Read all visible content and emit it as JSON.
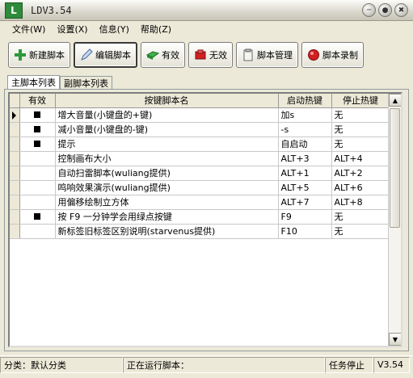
{
  "window": {
    "title": "LDV3.54",
    "icon_letter": "L"
  },
  "menu": [
    {
      "label": "文件(W)"
    },
    {
      "label": "设置(X)"
    },
    {
      "label": "信息(Y)"
    },
    {
      "label": "帮助(Z)"
    }
  ],
  "toolbar": {
    "new_label": "新建脚本",
    "edit_label": "编辑脚本",
    "enable_label": "有效",
    "disable_label": "无效",
    "manage_label": "脚本管理",
    "record_label": "脚本录制"
  },
  "tabs": [
    {
      "label": "主脚本列表"
    },
    {
      "label": "副脚本列表"
    }
  ],
  "grid": {
    "headers": {
      "enabled": "有效",
      "name": "按键脚本名",
      "start": "启动热键",
      "stop": "停止热键"
    },
    "rows": [
      {
        "enabled": true,
        "name": "增大音量(小键盘的+键)",
        "start": "加s",
        "stop": "无"
      },
      {
        "enabled": true,
        "name": "减小音量(小键盘的-键)",
        "start": "-s",
        "stop": "无"
      },
      {
        "enabled": true,
        "name": "提示",
        "start": "自启动",
        "stop": "无"
      },
      {
        "enabled": false,
        "name": "控制画布大小",
        "start": "ALT+3",
        "stop": "ALT+4"
      },
      {
        "enabled": false,
        "name": "自动扫雷脚本(wuliang提供)",
        "start": "ALT+1",
        "stop": "ALT+2"
      },
      {
        "enabled": false,
        "name": "鸣响效果演示(wuliang提供)",
        "start": "ALT+5",
        "stop": "ALT+6"
      },
      {
        "enabled": false,
        "name": "用偏移绘制立方体",
        "start": "ALT+7",
        "stop": "ALT+8"
      },
      {
        "enabled": true,
        "name": "按 F9 一分钟学会用绿点按键",
        "start": "F9",
        "stop": "无"
      },
      {
        "enabled": false,
        "name": "新标签旧标签区别说明(starvenus提供)",
        "start": "F10",
        "stop": "无"
      }
    ]
  },
  "status": {
    "category": "分类：默认分类",
    "running": "正在运行脚本：",
    "task": "任务停止",
    "version": "V3.54"
  },
  "colors": {
    "green_icon": "#2e8b3a",
    "red_icon": "#d32020"
  }
}
